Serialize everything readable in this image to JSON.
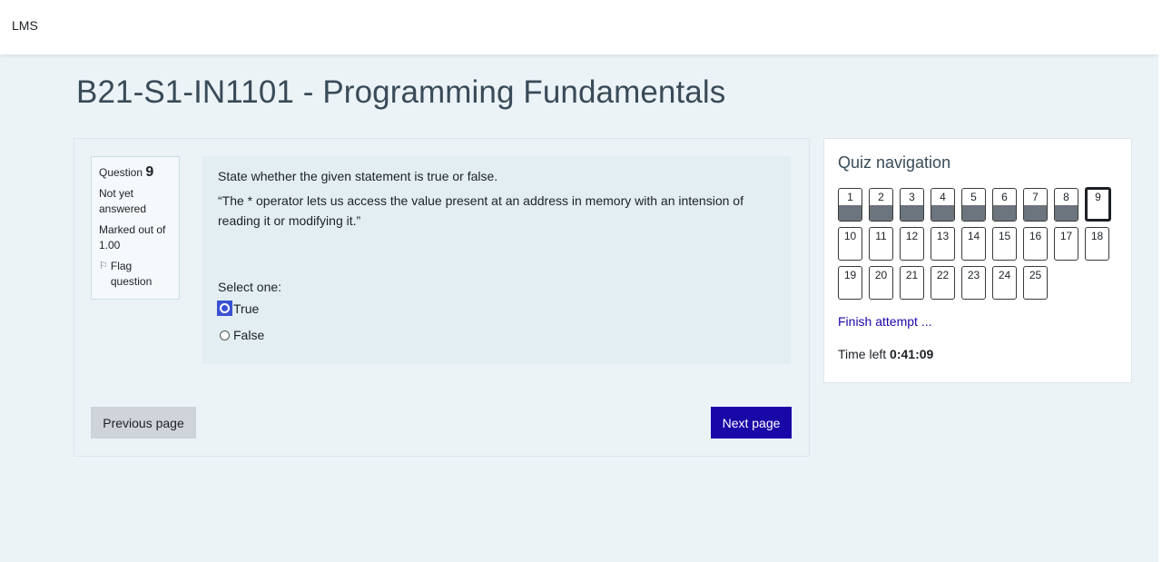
{
  "topbar": {
    "brand": "LMS"
  },
  "page": {
    "title": "B21-S1-IN1101 - Programming Fundamentals"
  },
  "question": {
    "label": "Question",
    "number": "9",
    "status": "Not yet answered",
    "marks": "Marked out of 1.00",
    "flag_label": "Flag question",
    "prompt": "State whether the given statement is true or false.",
    "statement": "“The * operator lets us access the value present at an address in memory with an intension of reading it or modifying it.”",
    "select_label": "Select one:",
    "options": [
      {
        "label": "True",
        "focused": true
      },
      {
        "label": "False",
        "focused": false
      }
    ]
  },
  "buttons": {
    "previous": "Previous page",
    "next": "Next page"
  },
  "quiz_nav": {
    "title": "Quiz navigation",
    "questions": [
      {
        "n": "1",
        "state": "answered"
      },
      {
        "n": "2",
        "state": "answered"
      },
      {
        "n": "3",
        "state": "answered"
      },
      {
        "n": "4",
        "state": "answered"
      },
      {
        "n": "5",
        "state": "answered"
      },
      {
        "n": "6",
        "state": "answered"
      },
      {
        "n": "7",
        "state": "answered"
      },
      {
        "n": "8",
        "state": "answered"
      },
      {
        "n": "9",
        "state": "current"
      },
      {
        "n": "10",
        "state": "unanswered"
      },
      {
        "n": "11",
        "state": "unanswered"
      },
      {
        "n": "12",
        "state": "unanswered"
      },
      {
        "n": "13",
        "state": "unanswered"
      },
      {
        "n": "14",
        "state": "unanswered"
      },
      {
        "n": "15",
        "state": "unanswered"
      },
      {
        "n": "16",
        "state": "unanswered"
      },
      {
        "n": "17",
        "state": "unanswered"
      },
      {
        "n": "18",
        "state": "unanswered"
      },
      {
        "n": "19",
        "state": "unanswered"
      },
      {
        "n": "20",
        "state": "unanswered"
      },
      {
        "n": "21",
        "state": "unanswered"
      },
      {
        "n": "22",
        "state": "unanswered"
      },
      {
        "n": "23",
        "state": "unanswered"
      },
      {
        "n": "24",
        "state": "unanswered"
      },
      {
        "n": "25",
        "state": "unanswered"
      }
    ],
    "finish_label": "Finish attempt ...",
    "time_label": "Time left",
    "time_value": "0:41:09"
  }
}
